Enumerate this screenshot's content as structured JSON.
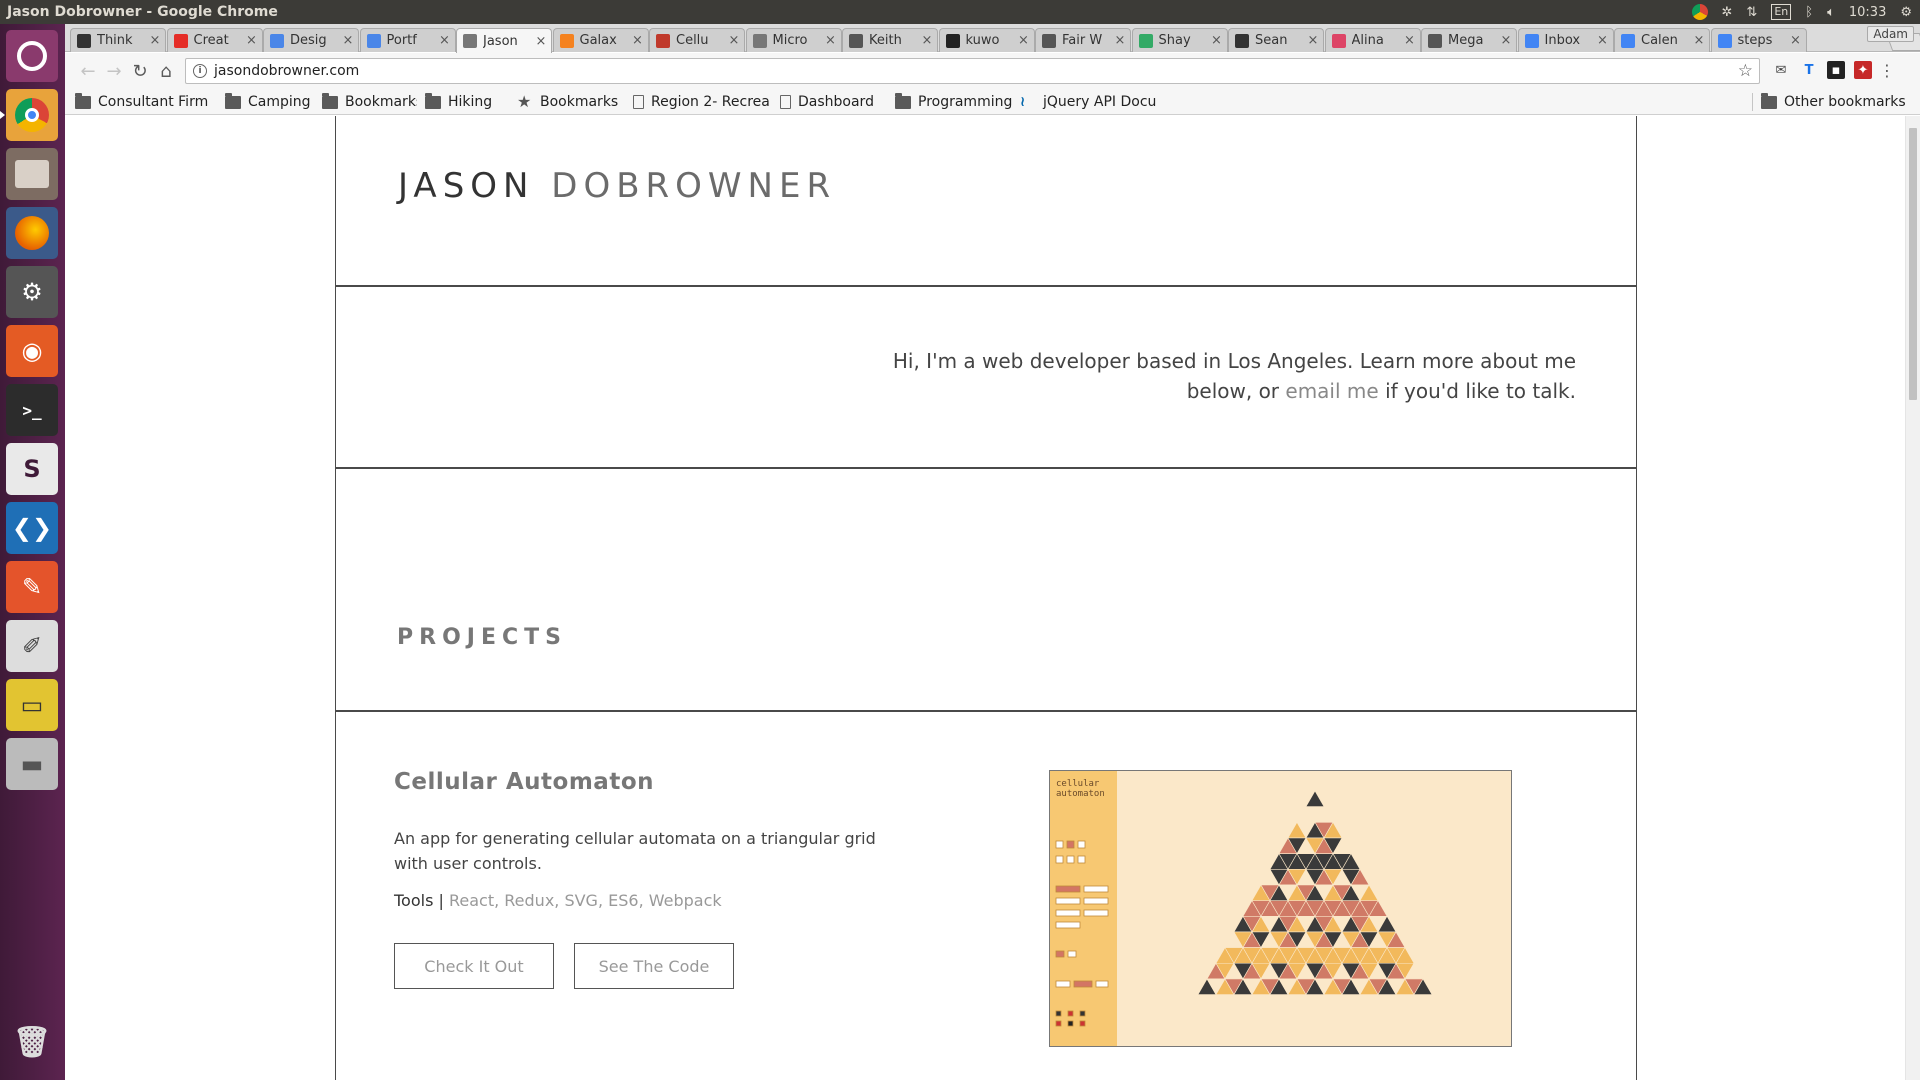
{
  "window": {
    "title": "Jason Dobrowner - Google Chrome"
  },
  "system": {
    "time": "10:33",
    "lang": "En",
    "user": "Adam"
  },
  "tabs": [
    {
      "label": "Think",
      "color": "#333"
    },
    {
      "label": "Creat",
      "color": "#e52d27"
    },
    {
      "label": "Desig",
      "color": "#4a86e8"
    },
    {
      "label": "Portf",
      "color": "#4a86e8"
    },
    {
      "label": "Jason",
      "color": "#777",
      "active": true
    },
    {
      "label": "Galax",
      "color": "#f5821f"
    },
    {
      "label": "Cellu",
      "color": "#c0392b"
    },
    {
      "label": "Micro",
      "color": "#777"
    },
    {
      "label": "Keith",
      "color": "#555"
    },
    {
      "label": "kuwo",
      "color": "#222"
    },
    {
      "label": "Fair W",
      "color": "#555"
    },
    {
      "label": "Shay",
      "color": "#3a6"
    },
    {
      "label": "Sean",
      "color": "#333"
    },
    {
      "label": "Alina",
      "color": "#d46"
    },
    {
      "label": "Mega",
      "color": "#555"
    },
    {
      "label": "Inbox",
      "color": "#4285f4"
    },
    {
      "label": "Calen",
      "color": "#4285f4"
    },
    {
      "label": "steps",
      "color": "#4285f4"
    }
  ],
  "address": {
    "url": "jasondobrowner.com"
  },
  "bookmarks": [
    {
      "label": "Consultant Firm",
      "icon": "folder"
    },
    {
      "label": "Camping",
      "icon": "folder"
    },
    {
      "label": "Bookmarks",
      "icon": "folder"
    },
    {
      "label": "Hiking",
      "icon": "folder"
    },
    {
      "label": "Bookmarks",
      "icon": "star"
    },
    {
      "label": "Region 2- Recrea",
      "icon": "page"
    },
    {
      "label": "Dashboard",
      "icon": "page"
    },
    {
      "label": "Programming",
      "icon": "folder"
    },
    {
      "label": "jQuery API Docu",
      "icon": "jquery"
    }
  ],
  "other_bookmarks": "Other bookmarks",
  "site": {
    "first_name": "JASON",
    "last_name": "DOBROWNER",
    "intro_before": "Hi, I'm a web developer based in Los Angeles. Learn more about me below, or",
    "intro_link": "email me",
    "intro_after": "if you'd like to talk.",
    "projects_heading": "PROJECTS",
    "project": {
      "title": "Cellular Automaton",
      "description": "An app for generating cellular automata on a triangular grid with user controls.",
      "tools_label": "Tools |",
      "tools": "React, Redux, SVG, ES6, Webpack",
      "button_primary": "Check It Out",
      "button_secondary": "See The Code",
      "thumb_title": "cellular automaton"
    }
  }
}
